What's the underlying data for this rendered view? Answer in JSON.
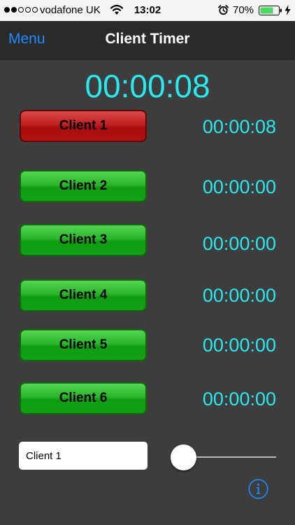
{
  "status_bar": {
    "carrier": "vodafone UK",
    "time": "13:02",
    "battery": "70%",
    "signal_bars_filled": 2,
    "signal_bars_total": 5
  },
  "nav": {
    "menu_label": "Menu",
    "title": "Client Timer"
  },
  "total_time": "00:00:08",
  "clients": [
    {
      "label": "Client 1",
      "time": "00:00:08",
      "state": "active"
    },
    {
      "label": "Client 2",
      "time": "00:00:00",
      "state": "idle"
    },
    {
      "label": "Client 3",
      "time": "00:00:00",
      "state": "idle"
    },
    {
      "label": "Client 4",
      "time": "00:00:00",
      "state": "idle"
    },
    {
      "label": "Client 5",
      "time": "00:00:00",
      "state": "idle"
    },
    {
      "label": "Client 6",
      "time": "00:00:00",
      "state": "idle"
    }
  ],
  "name_field": {
    "value": "Client 1"
  },
  "slider": {
    "value": 0
  },
  "icons": {
    "wifi": "wifi-icon",
    "alarm": "alarm-icon",
    "battery": "battery-icon",
    "charging": "charging-icon",
    "info": "info-icon"
  },
  "colors": {
    "background": "#3d3d3d",
    "nav_background": "#2a2a2a",
    "timer_text": "#29e8f0",
    "link": "#1c8cff",
    "active_button": "#c02020",
    "idle_button": "#2ab52a"
  }
}
